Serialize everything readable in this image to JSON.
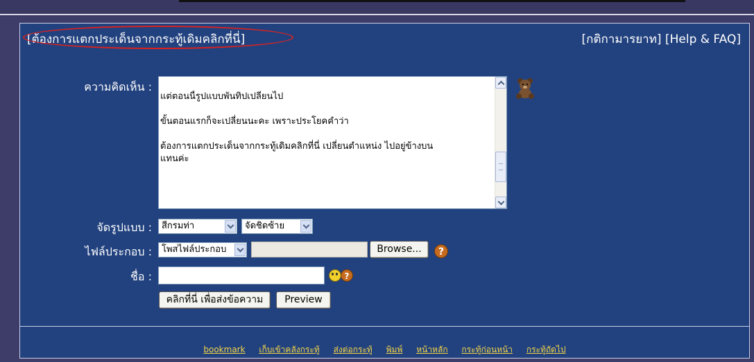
{
  "header": {
    "branch_link": "[ต้องการแตกประเด็นจากกระทู้เดิมคลิกที่นี่]",
    "rules_link": "[กติกามารยาท]",
    "help_link": "[Help & FAQ]"
  },
  "form": {
    "comment_label": "ความคิดเห็น :",
    "comment_text": "แต่ตอนนี้รูปแบบพันทิปเปลี่ยนไป\n\nขั้นตอนแรกก็จะเปลี่ยนนะคะ เพราะประโยคคำว่า\n\nต้องการแตกประเด็นจากกระทู้เดิมคลิกที่นี่ เปลี่ยนตำแหน่ง ไปอยู่ข้างบน\nแทนค่ะ",
    "format_label": "จัดรูปแบบ :",
    "color_select": "สีกรมท่า",
    "align_select": "จัดชิดซ้าย",
    "attachment_label": "ไฟล์ประกอบ :",
    "attachment_select": "โพสไฟล์ประกอบ",
    "browse_button": "Browse...",
    "name_label": "ชื่อ :",
    "help_icon_glyph": "?",
    "submit_button": "คลิกที่นี่ เพื่อส่งข้อความ",
    "preview_button": "Preview"
  },
  "footer": {
    "links": [
      "bookmark",
      "เก็บเข้าคลังกระทู้",
      "ส่งต่อกระทู้",
      "พิมพ์",
      "หน้าหลัก",
      "กระทู้ก่อนหน้า",
      "กระทู้ถัดไป"
    ]
  },
  "colors": {
    "panel_bg": "#22427f",
    "page_bg": "#3e3d6a",
    "footer_link": "#f5d547",
    "highlight_ellipse": "#e0201d"
  }
}
